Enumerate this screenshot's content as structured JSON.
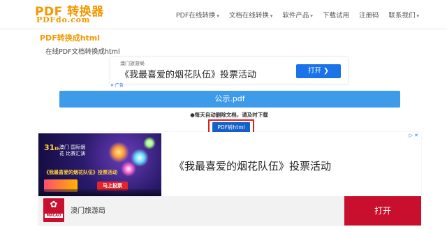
{
  "logo": {
    "main": "PDF 转换器",
    "sub": "PDFdo.com"
  },
  "nav": [
    {
      "label": "PDF在线转换",
      "caret": "▾"
    },
    {
      "label": "文档在线转换",
      "caret": "▾"
    },
    {
      "label": "软件产品",
      "caret": "▾"
    },
    {
      "label": "下载试用",
      "caret": ""
    },
    {
      "label": "注册码",
      "caret": ""
    },
    {
      "label": "联系我们",
      "caret": "▾"
    }
  ],
  "page": {
    "title": "PDF转换成html",
    "subtitle": "在线PDF文档转换成html"
  },
  "ad_small": {
    "source": "澳门旅游局",
    "headline": "《我最喜爱的烟花队伍》投票活动",
    "button": "打开  ❯",
    "adchoice": "✕ 广告"
  },
  "file": {
    "name": "公示.pdf",
    "notice": "●每天自动删除文档，请及时下载"
  },
  "convert_button": "PDF转html",
  "ad_large": {
    "banner": {
      "edition": "31",
      "edition_suffix": "th",
      "title": "澳门 国际烟花 比赛汇演",
      "vote_text": "《我最喜爱的烟花队伍》投票活动",
      "vote_button": "马上投票"
    },
    "headline": "《我最喜爱的烟花队伍》投票活动",
    "adchoice": "▷ ✕",
    "logo_word": "MACAO",
    "advertiser": "澳门旅游局",
    "open_button": "打开"
  }
}
